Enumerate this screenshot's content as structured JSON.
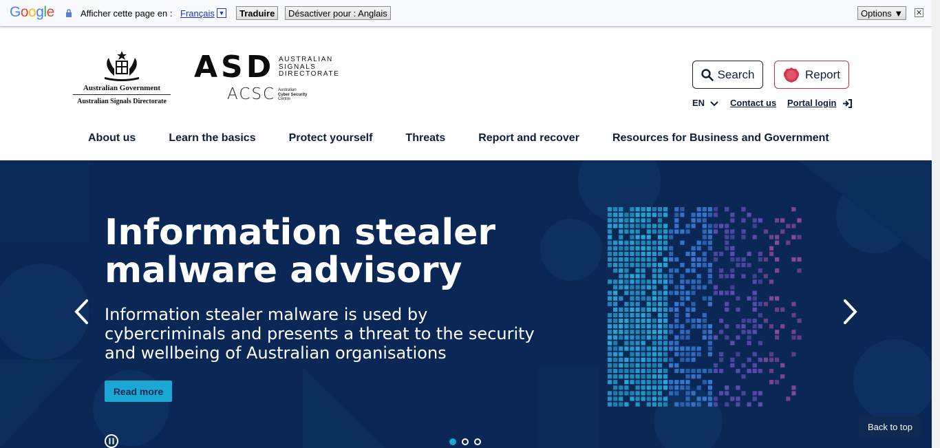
{
  "translate_bar": {
    "brand": "Google",
    "prompt": "Afficher cette page en :",
    "language": "Français",
    "translate_button": "Traduire",
    "disable_button": "Désactiver pour : Anglais",
    "options_button": "Options ▼"
  },
  "header": {
    "gov_name": "Australian Government",
    "gov_department": "Australian Signals Directorate",
    "asd_mark": "ASD",
    "asd_subtitle": [
      "AUSTRALIAN",
      "SIGNALS",
      "DIRECTORATE"
    ],
    "acsc_mark": "ACSC",
    "acsc_subtitle": [
      "Australian",
      "Cyber Security",
      "Centre"
    ],
    "search_label": "Search",
    "report_label": "Report",
    "language": "EN",
    "contact_label": "Contact us",
    "portal_label": "Portal login"
  },
  "nav": {
    "items": [
      "About us",
      "Learn the basics",
      "Protect yourself",
      "Threats",
      "Report and recover",
      "Resources for Business and Government"
    ]
  },
  "hero": {
    "title": "Information stealer malware advisory",
    "subtitle": "Information stealer malware is used by cybercriminals and presents a threat to the security and wellbeing of Australian organisations",
    "cta": "Read more",
    "back_to_top": "Back to top",
    "slides": 3,
    "active_slide": 1
  },
  "colors": {
    "hero_bg": "#0a2756",
    "accent": "#1aa7d4",
    "report_border": "#c4314b",
    "text_dark": "#0f1e3c"
  }
}
